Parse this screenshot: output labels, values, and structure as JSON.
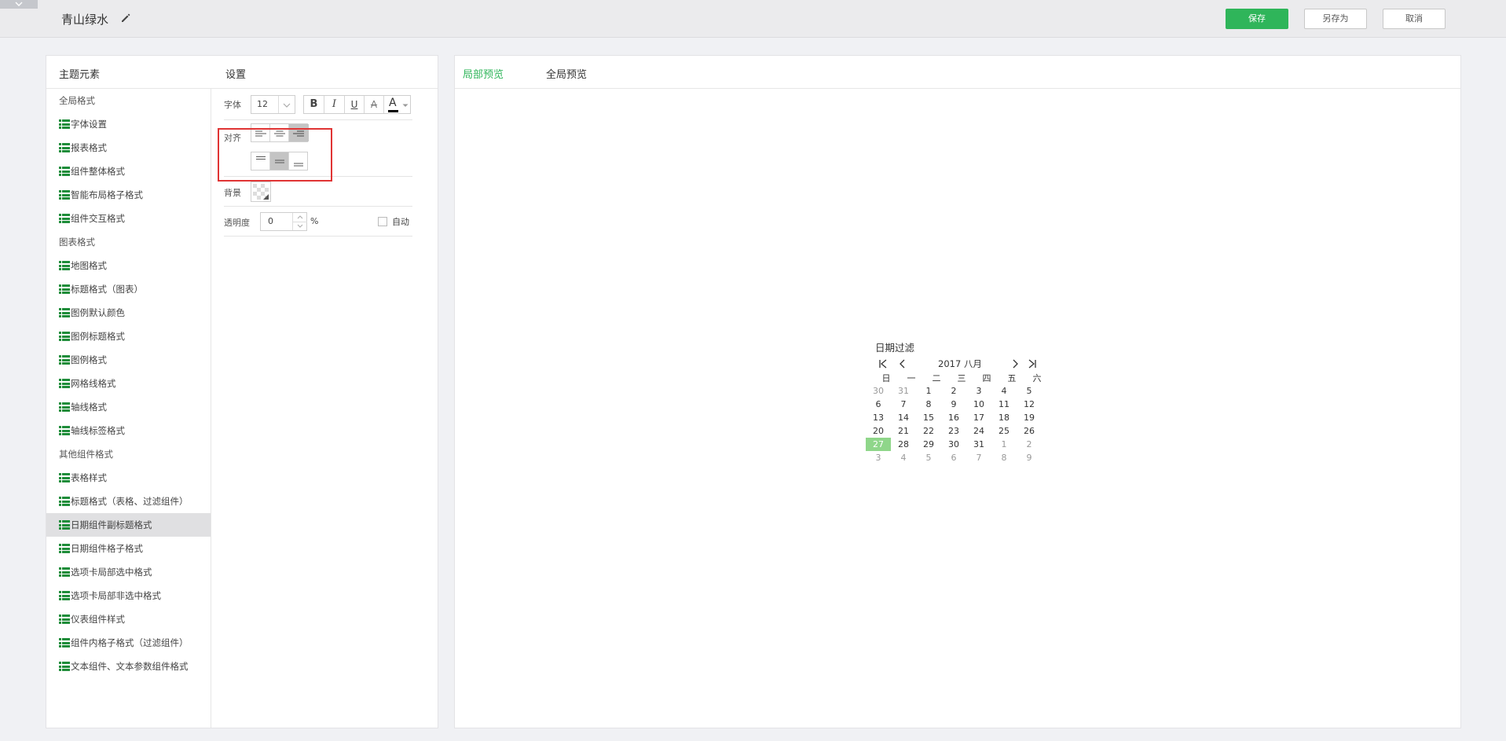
{
  "header": {
    "theme_name": "青山绿水",
    "save_label": "保存",
    "save_as_label": "另存为",
    "cancel_label": "取消",
    "accent_color": "#2fb55a"
  },
  "left_panel": {
    "elements_title": "主题元素",
    "settings_title": "设置",
    "tree": [
      {
        "label": "全局格式",
        "type": "group"
      },
      {
        "label": "字体设置",
        "type": "leaf"
      },
      {
        "label": "报表格式",
        "type": "leaf"
      },
      {
        "label": "组件整体格式",
        "type": "leaf"
      },
      {
        "label": "智能布局格子格式",
        "type": "leaf"
      },
      {
        "label": "组件交互格式",
        "type": "leaf"
      },
      {
        "label": "图表格式",
        "type": "group"
      },
      {
        "label": "地图格式",
        "type": "leaf"
      },
      {
        "label": "标题格式（图表）",
        "type": "leaf"
      },
      {
        "label": "图例默认颜色",
        "type": "leaf"
      },
      {
        "label": "图例标题格式",
        "type": "leaf"
      },
      {
        "label": "图例格式",
        "type": "leaf"
      },
      {
        "label": "网格线格式",
        "type": "leaf"
      },
      {
        "label": "轴线格式",
        "type": "leaf"
      },
      {
        "label": "轴线标签格式",
        "type": "leaf"
      },
      {
        "label": "其他组件格式",
        "type": "group"
      },
      {
        "label": "表格样式",
        "type": "leaf"
      },
      {
        "label": "标题格式（表格、过滤组件）",
        "type": "leaf"
      },
      {
        "label": "日期组件副标题格式",
        "type": "leaf",
        "selected": true
      },
      {
        "label": "日期组件格子格式",
        "type": "leaf"
      },
      {
        "label": "选项卡局部选中格式",
        "type": "leaf"
      },
      {
        "label": "选项卡局部非选中格式",
        "type": "leaf"
      },
      {
        "label": "仪表组件样式",
        "type": "leaf"
      },
      {
        "label": "组件内格子格式（过滤组件）",
        "type": "leaf"
      },
      {
        "label": "文本组件、文本参数组件格式",
        "type": "leaf"
      }
    ],
    "settings": {
      "font_label": "字体",
      "font_size": "12",
      "bold": "B",
      "italic": "I",
      "underline": "U",
      "strike": "A",
      "color": "A",
      "align_label": "对齐",
      "background_label": "背景",
      "opacity_label": "透明度",
      "opacity_value": "0",
      "percent": "%",
      "auto_label": "自动"
    }
  },
  "preview": {
    "tab_local": "局部预览",
    "tab_global": "全局预览",
    "calendar": {
      "title": "日期过滤",
      "year": "2017",
      "month": "八月",
      "weekdays": [
        "日",
        "一",
        "二",
        "三",
        "四",
        "五",
        "六"
      ],
      "weeks": [
        [
          "30",
          "31",
          "1",
          "2",
          "3",
          "4",
          "5"
        ],
        [
          "6",
          "7",
          "8",
          "9",
          "10",
          "11",
          "12"
        ],
        [
          "13",
          "14",
          "15",
          "16",
          "17",
          "18",
          "19"
        ],
        [
          "20",
          "21",
          "22",
          "23",
          "24",
          "25",
          "26"
        ],
        [
          "27",
          "28",
          "29",
          "30",
          "31",
          "1",
          "2"
        ],
        [
          "3",
          "4",
          "5",
          "6",
          "7",
          "8",
          "9"
        ]
      ],
      "today_color": "#8fd68a"
    }
  }
}
